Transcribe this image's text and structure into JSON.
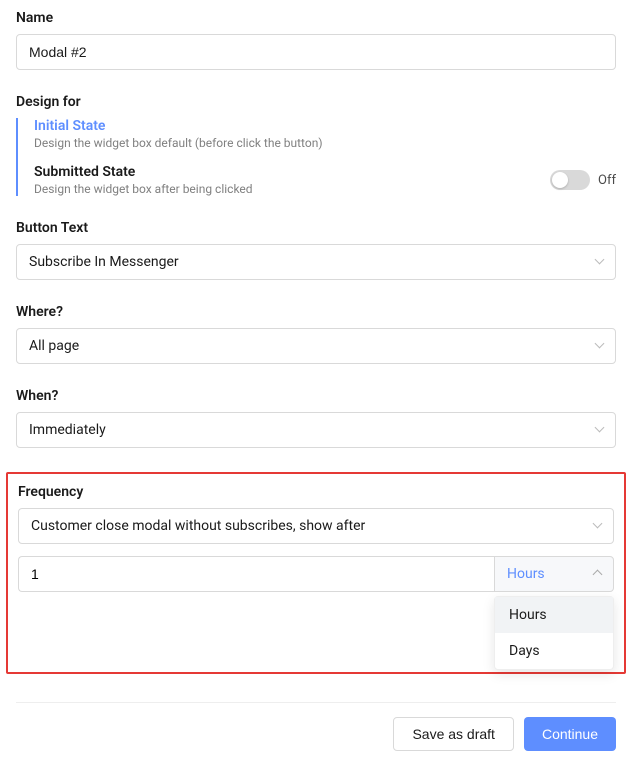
{
  "name": {
    "label": "Name",
    "value": "Modal #2"
  },
  "design_for": {
    "label": "Design for",
    "states": [
      {
        "title": "Initial State",
        "desc": "Design the widget box default (before click the button)",
        "active": true
      },
      {
        "title": "Submitted State",
        "desc": "Design the widget box after being clicked",
        "toggle_label": "Off"
      }
    ]
  },
  "button_text": {
    "label": "Button Text",
    "value": "Subscribe In Messenger"
  },
  "where": {
    "label": "Where?",
    "value": "All page"
  },
  "when": {
    "label": "When?",
    "value": "Immediately"
  },
  "frequency": {
    "label": "Frequency",
    "condition": "Customer close modal without subscribes, show after",
    "amount": "1",
    "unit": "Hours",
    "options": [
      "Hours",
      "Days"
    ]
  },
  "footer": {
    "save_draft": "Save as draft",
    "continue": "Continue"
  }
}
